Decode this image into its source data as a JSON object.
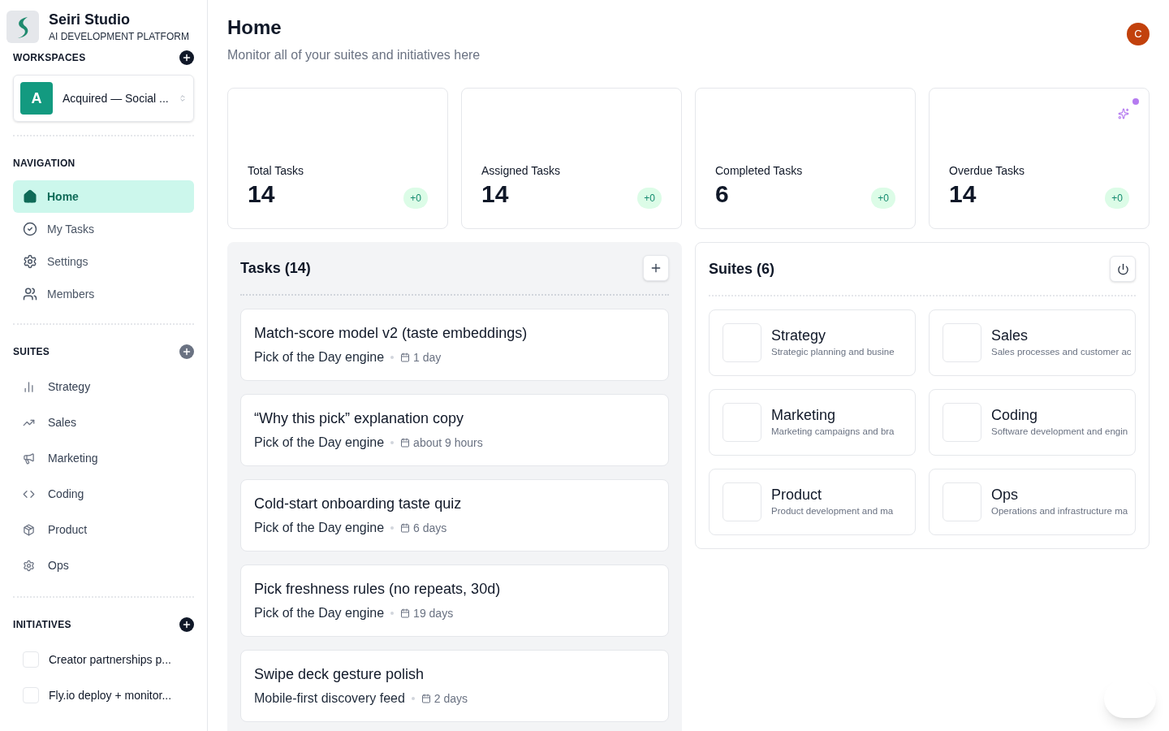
{
  "brand": {
    "name": "Seiri Studio",
    "tagline": "AI DEVELOPMENT PLATFORM"
  },
  "workspaces": {
    "heading": "WORKSPACES",
    "current": {
      "initial": "A",
      "name": "Acquired — Social ..."
    }
  },
  "navigation": {
    "heading": "NAVIGATION",
    "items": [
      {
        "kind": "home",
        "label": "Home",
        "selected": true
      },
      {
        "kind": "check",
        "label": "My Tasks",
        "selected": false
      },
      {
        "kind": "gear",
        "label": "Settings",
        "selected": false
      },
      {
        "kind": "users",
        "label": "Members",
        "selected": false
      }
    ]
  },
  "suites_nav": {
    "heading": "SUITES",
    "items": [
      {
        "kind": "chart",
        "label": "Strategy"
      },
      {
        "kind": "trend",
        "label": "Sales"
      },
      {
        "kind": "megaphone",
        "label": "Marketing"
      },
      {
        "kind": "code",
        "label": "Coding"
      },
      {
        "kind": "box",
        "label": "Product"
      },
      {
        "kind": "gear",
        "label": "Ops"
      }
    ]
  },
  "initiatives": {
    "heading": "INITIATIVES",
    "items": [
      {
        "label": "Creator partnerships p...",
        "checked": false
      },
      {
        "label": "Fly.io deploy + monitor...",
        "checked": false
      }
    ]
  },
  "header": {
    "title": "Home",
    "subtitle": "Monitor all of your suites and initiatives here",
    "avatar": "C"
  },
  "stats": [
    {
      "label": "Total Tasks",
      "value": "14",
      "delta": "+0",
      "sparkle": false
    },
    {
      "label": "Assigned Tasks",
      "value": "14",
      "delta": "+0",
      "sparkle": false
    },
    {
      "label": "Completed Tasks",
      "value": "6",
      "delta": "+0",
      "sparkle": false
    },
    {
      "label": "Overdue Tasks",
      "value": "14",
      "delta": "+0",
      "sparkle": true
    }
  ],
  "tasks": {
    "title": "Tasks (14)",
    "items": [
      {
        "title": "Match-score model v2 (taste embeddings)",
        "project": "Pick of the Day engine",
        "due": "1 day"
      },
      {
        "title": "“Why this pick” explanation copy",
        "project": "Pick of the Day engine",
        "due": "about 9 hours"
      },
      {
        "title": "Cold-start onboarding taste quiz",
        "project": "Pick of the Day engine",
        "due": "6 days"
      },
      {
        "title": "Pick freshness rules (no repeats, 30d)",
        "project": "Pick of the Day engine",
        "due": "19 days"
      },
      {
        "title": "Swipe deck gesture polish",
        "project": "Mobile-first discovery feed",
        "due": "2 days"
      }
    ]
  },
  "suites": {
    "title": "Suites (6)",
    "items": [
      {
        "name": "Strategy",
        "description": "Strategic planning and busine"
      },
      {
        "name": "Sales",
        "description": "Sales processes and customer ac"
      },
      {
        "name": "Marketing",
        "description": "Marketing campaigns and bra"
      },
      {
        "name": "Coding",
        "description": "Software development and engin"
      },
      {
        "name": "Product",
        "description": "Product development and ma"
      },
      {
        "name": "Ops",
        "description": "Operations and infrastructure ma"
      }
    ]
  }
}
